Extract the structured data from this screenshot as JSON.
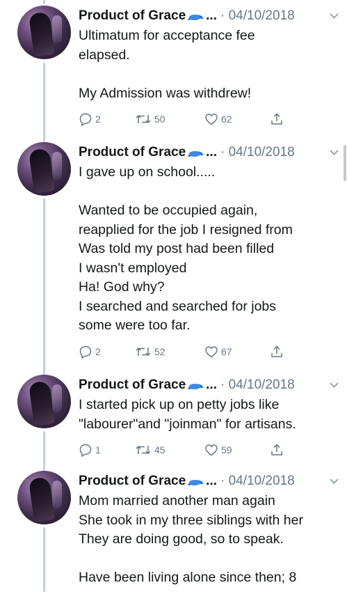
{
  "tweets": [
    {
      "name": "Product of Grace",
      "ellipsis": "...",
      "date": "· 04/10/2018",
      "text": "Ultimatum for acceptance fee\nelapsed.\n\nMy Admission was withdrew!",
      "replies": "2",
      "retweets": "50",
      "likes": "62"
    },
    {
      "name": "Product of Grace",
      "ellipsis": "...",
      "date": "· 04/10/2018",
      "text": "I gave up on school.....\n\nWanted to be occupied again,\nreapplied for the job I resigned from\nWas told my post had been filled\nI wasn't employed\nHa! God why?\nI searched and searched for jobs\nsome were too far.",
      "replies": "2",
      "retweets": "52",
      "likes": "67"
    },
    {
      "name": "Product of Grace",
      "ellipsis": "...",
      "date": "· 04/10/2018",
      "text": "I started pick up on petty jobs like\n\"labourer\"and \"joinman\" for artisans.",
      "replies": "1",
      "retweets": "45",
      "likes": "59"
    },
    {
      "name": "Product of Grace",
      "ellipsis": "...",
      "date": "· 04/10/2018",
      "text": "Mom married another man again\nShe took in my three siblings with her\nThey are doing good, so to speak.\n\nHave been living alone since then; 8",
      "replies": "",
      "retweets": "",
      "likes": ""
    }
  ],
  "colors": {
    "text": "#14171a",
    "muted": "#657786",
    "thread_line": "#c4cfd6",
    "emoji_blue": "#1d6fd1"
  },
  "icons": [
    "reply-icon",
    "retweet-icon",
    "like-icon",
    "share-icon",
    "chevron-down-icon",
    "cap-emoji-icon"
  ]
}
